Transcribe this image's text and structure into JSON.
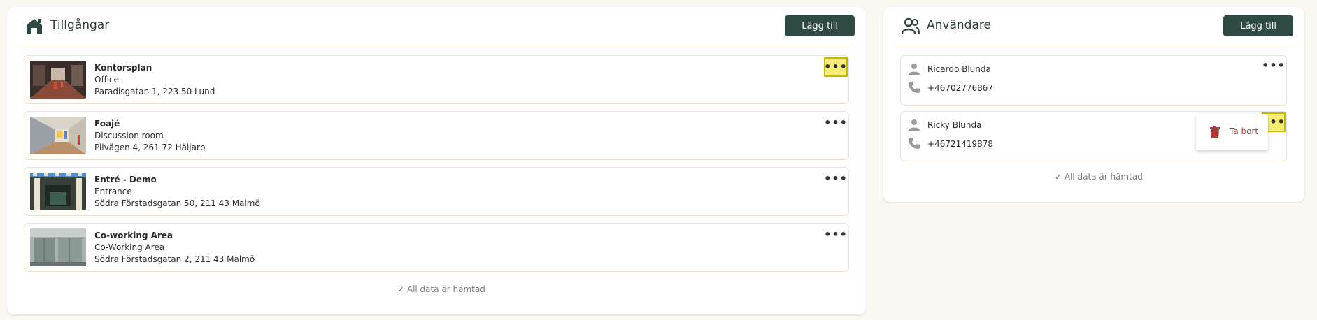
{
  "assets": {
    "title": "Tillgångar",
    "add_label": "Lägg till",
    "items": [
      {
        "name": "Kontorsplan",
        "type": "Office",
        "address": "Paradisgatan 1, 223 50 Lund"
      },
      {
        "name": "Foajé",
        "type": "Discussion room",
        "address": "Pilvägen 4, 261 72 Häljarp"
      },
      {
        "name": "Entré - Demo",
        "type": "Entrance",
        "address": "Södra Förstadsgatan 50, 211 43 Malmö"
      },
      {
        "name": "Co-working Area",
        "type": "Co-Working Area",
        "address": "Södra Förstadsgatan 2, 211 43 Malmö"
      }
    ],
    "status": "✓ All data är hämtad"
  },
  "users": {
    "title": "Användare",
    "add_label": "Lägg till",
    "items": [
      {
        "name": "Ricardo Blunda",
        "phone": "+46702776867"
      },
      {
        "name": "Ricky Blunda",
        "phone": "+46721419878"
      }
    ],
    "status": "✓ All data är hämtad"
  },
  "context_menu": {
    "delete_label": "Ta bort"
  },
  "menu_glyph": "•••",
  "colors": {
    "primary_button": "#2f4a45",
    "highlight": "#f7ee7a",
    "danger": "#b03a3a"
  }
}
